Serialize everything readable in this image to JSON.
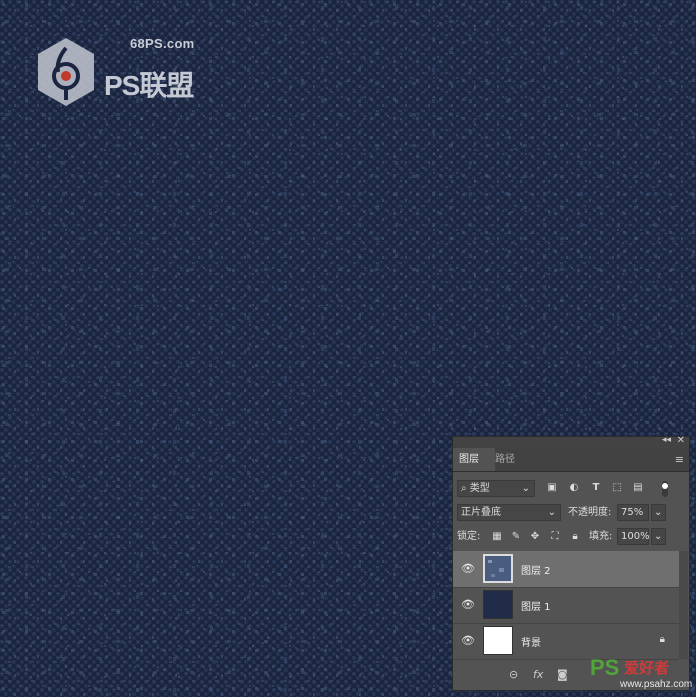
{
  "watermark": {
    "domain": "68PS.com",
    "brand": "PS联盟"
  },
  "panel": {
    "tabs": [
      {
        "label": "图层",
        "active": true
      },
      {
        "label": "路径",
        "active": false
      }
    ],
    "filter": {
      "kind_label": "类型",
      "search_icon": "search-icon"
    },
    "filter_icons": [
      "image-filter-icon",
      "adjustment-filter-icon",
      "type-filter-icon",
      "shape-filter-icon",
      "smart-object-filter-icon",
      "toggle-filter-icon"
    ],
    "blend_mode": "正片叠底",
    "opacity_label": "不透明度:",
    "opacity_value": "75%",
    "lock_label": "锁定:",
    "lock_icons": [
      "lock-transparent-icon",
      "lock-image-icon",
      "lock-position-icon",
      "lock-artboard-icon",
      "lock-all-icon"
    ],
    "fill_label": "填充:",
    "fill_value": "100%",
    "layers": [
      {
        "name": "图层 2",
        "selected": true,
        "visible": true,
        "locked": false
      },
      {
        "name": "图层 1",
        "selected": false,
        "visible": true,
        "locked": false
      },
      {
        "name": "背景",
        "selected": false,
        "visible": true,
        "locked": true
      }
    ],
    "bottom_icons": [
      "link-icon",
      "fx-icon",
      "mask-icon"
    ],
    "fx_label": "fx"
  },
  "site": {
    "ps": "PS",
    "cn": "爱好者",
    "url": "www.psahz.com"
  },
  "colors": {
    "canvas": "#1b2540",
    "panel": "#535353",
    "selected_layer": "#6f6f6f",
    "site_green": "#52a43a",
    "site_red": "#cf3b3b"
  }
}
